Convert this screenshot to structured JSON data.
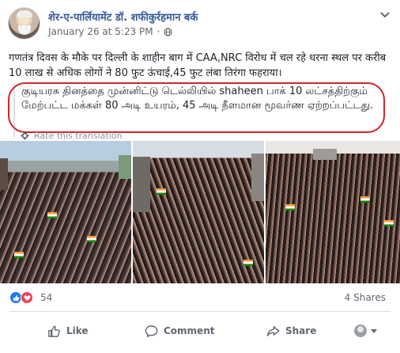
{
  "post": {
    "author": "शेर-ए-पार्लियामेंट डॉ. शफीकुर्रहमान बर्क",
    "timestamp": "January 26 at 5:23 PM",
    "separator": "·",
    "audience_icon": "globe-icon",
    "text": "गणतंत्र दिवस के मौके पर दिल्ली के शाहीन बाग में CAA,NRC विरोध में चल रहे धरना स्थल पर करीब 10 लाख से अधिक लोगों ने 80 फुट ऊंचाई,45 फुट लंबा तिरंगा फहराया।"
  },
  "translation": {
    "text": "குடியரசு தினத்தை முன்னிட்டு டெல்லியில் shaheen பாக் 10 லட்சத்திற்கும் மேற்பட்ட மக்கள் 80 அடி உயரம், 45 அடி நீளமான மூவர்ண ஏற்றப்பட்டது.",
    "rate_label": "Rate this translation",
    "highlight_color": "#d0262a"
  },
  "photos": [
    {
      "name": "crowd-photo-1"
    },
    {
      "name": "crowd-photo-2"
    },
    {
      "name": "crowd-photo-3"
    }
  ],
  "stats": {
    "reaction_count": "54",
    "shares": "4 Shares",
    "reactions": [
      "like-icon",
      "love-icon"
    ]
  },
  "actions": {
    "like": "Like",
    "comment": "Comment",
    "share": "Share"
  },
  "colors": {
    "link_blue": "#385898",
    "like_blue": "#2078f4",
    "love_red": "#f33e58",
    "muted": "#616770"
  }
}
